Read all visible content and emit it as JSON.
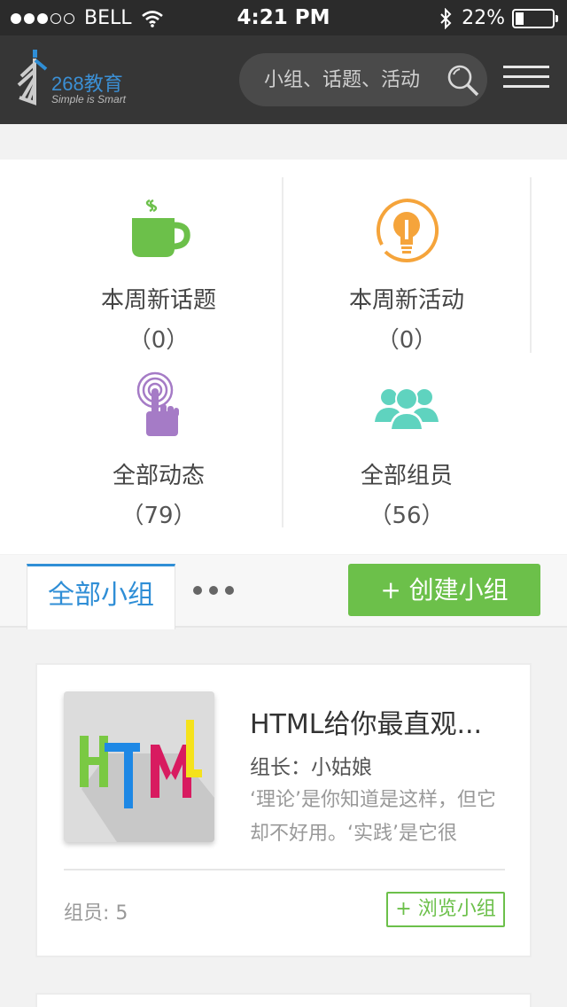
{
  "status_bar": {
    "carrier": "BELL",
    "time": "4:21 PM",
    "battery_text": "22%",
    "battery_level": 0.22
  },
  "header": {
    "logo_text": "268教育",
    "logo_tagline": "Simple is Smart",
    "search_placeholder": "小组、话题、活动",
    "icons": [
      "search-icon",
      "menu-icon"
    ]
  },
  "stats": [
    {
      "label": "本周新话题",
      "count": "（0）",
      "icon": "coffee-cup-icon",
      "color": "#6cc04a"
    },
    {
      "label": "本周新活动",
      "count": "（0）",
      "icon": "lightbulb-icon",
      "color": "#f5a43b"
    },
    {
      "label": "全部动态",
      "count": "（79）",
      "icon": "touch-icon",
      "color": "#a57bc6"
    },
    {
      "label": "全部组员",
      "count": "（56）",
      "icon": "members-icon",
      "color": "#5fd3bf"
    }
  ],
  "tabs": {
    "active_label": "全部小组",
    "create_label": "+ 创建小组"
  },
  "groups": [
    {
      "title": "HTML给你最直观...",
      "leader": "组长：小姑娘",
      "description": "‘理论’是你知道是这样，但它却不好用。‘实践’是它很",
      "members": "组员: 5",
      "browse_label": "+ 浏览小组",
      "thumb_text": "HTML"
    }
  ],
  "colors": {
    "accent_blue": "#2f8ed6",
    "accent_green": "#6cc04a",
    "header_bg": "#363636"
  }
}
